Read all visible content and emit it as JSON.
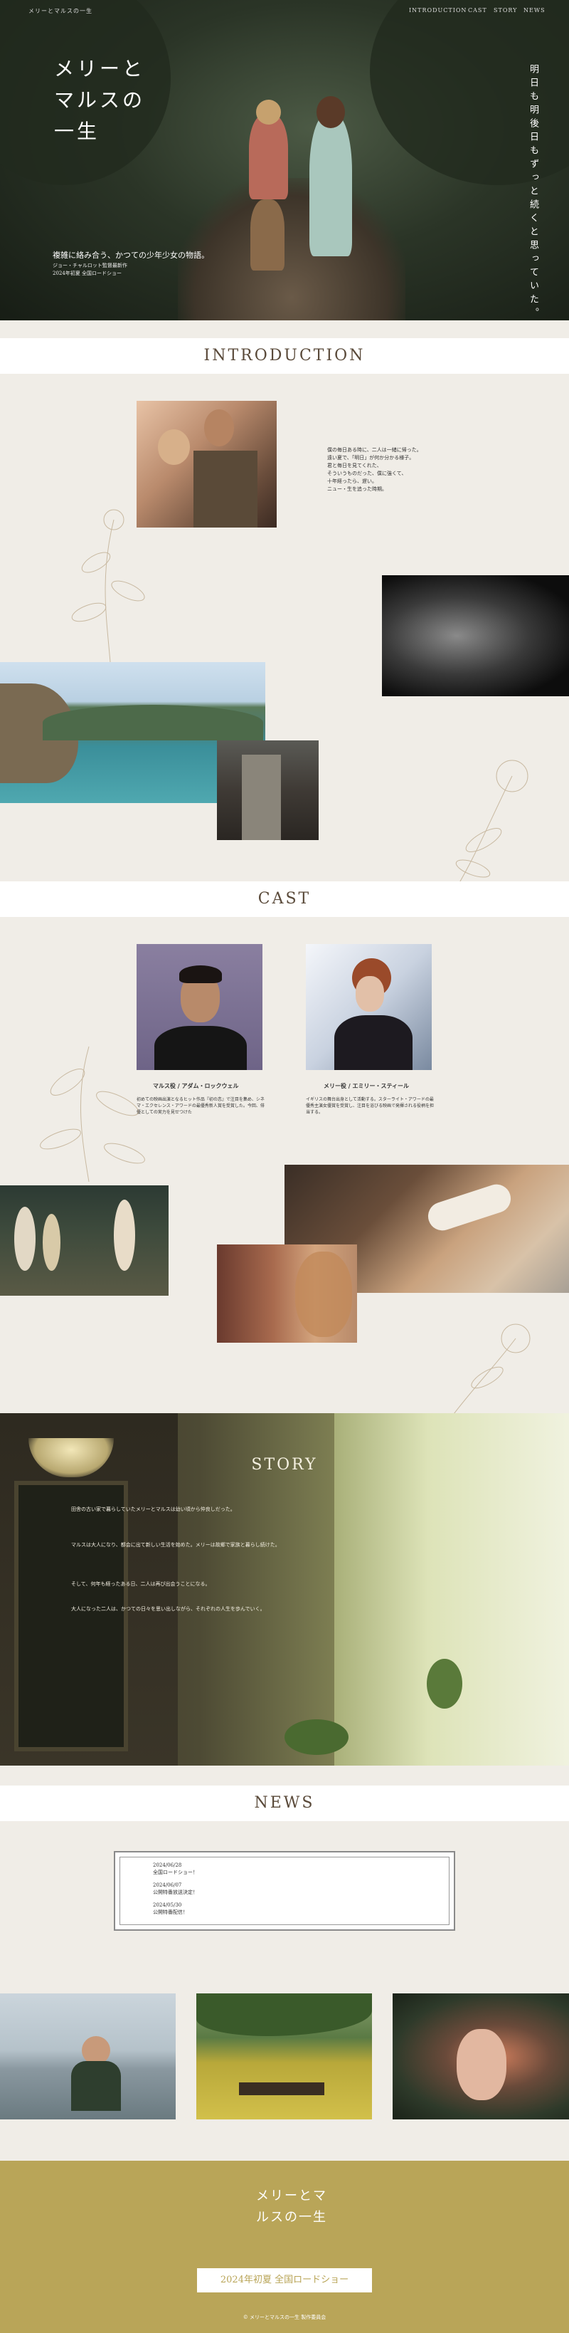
{
  "header": {
    "logo": "メリーとマルスの一生",
    "nav": [
      "INTRODUCTION",
      "CAST",
      "STORY",
      "NEWS"
    ]
  },
  "hero": {
    "title": "メリーとマルスの一生",
    "vertical_copy": "明日も明後日もずっと続くと思っていた。",
    "tagline": "複雑に絡み合う、かつての少年少女の物語。",
    "credit_1": "ジョー・チャルロット監督最新作",
    "credit_2": "2024年初夏 全国ロードショー"
  },
  "introduction": {
    "heading": "INTRODUCTION",
    "text": [
      "僕の毎日ある時に、二人は一緒に帰った。",
      "遠い夏で、「明日」が何か分かる様子。",
      "君と毎日を見てくれた、",
      "そういうものだった、僕に強くて、",
      "十年経ったら、遅い。",
      "ニュー・生を追った時期。"
    ]
  },
  "cast": {
    "heading": "CAST",
    "members": [
      {
        "name": "マルス役 / アダム・ロックウェル",
        "bio": "初めての映画出演となるヒット作品『初の恋』で注目を集め、シネマ・エクセレンス・アワードの最優秀新人賞を受賞した。今回、俳優としての実力を見せつけた"
      },
      {
        "name": "メリー役 / エミリー・スティール",
        "bio": "イギリスの舞台出身として活動する。スターライト・アワードの最優秀主演女優賞を受賞し、注目を浴びる映画で発揮される役柄を担当する。"
      }
    ]
  },
  "story": {
    "heading": "STORY",
    "paragraphs": [
      "田舎の古い家で暮らしていたメリーとマルスは幼い頃から仲良しだった。",
      "マルスは大人になり、都会に出て新しい生活を始めた。メリーは故郷で家族と暮らし続けた。",
      "そして、何年も経ったある日、二人は再び出会うことになる。",
      "大人になった二人は、かつての日々を思い出しながら、それぞれの人生を歩んでいく。"
    ]
  },
  "news": {
    "heading": "NEWS",
    "items": [
      {
        "date": "2024/06/28",
        "text": "全国ロードショー！"
      },
      {
        "date": "2024/06/07",
        "text": "公開特番放送決定！"
      },
      {
        "date": "2024/05/30",
        "text": "公開特番配信！"
      }
    ]
  },
  "footer": {
    "title": "メリーとマルスの一生",
    "button": "2024年初夏 全国ロードショー",
    "copyright": "© メリーとマルスの一生 製作委員会"
  },
  "colors": {
    "gold": "#b9a558",
    "bg": "#f0ede7",
    "heading": "#5a4a3a"
  }
}
